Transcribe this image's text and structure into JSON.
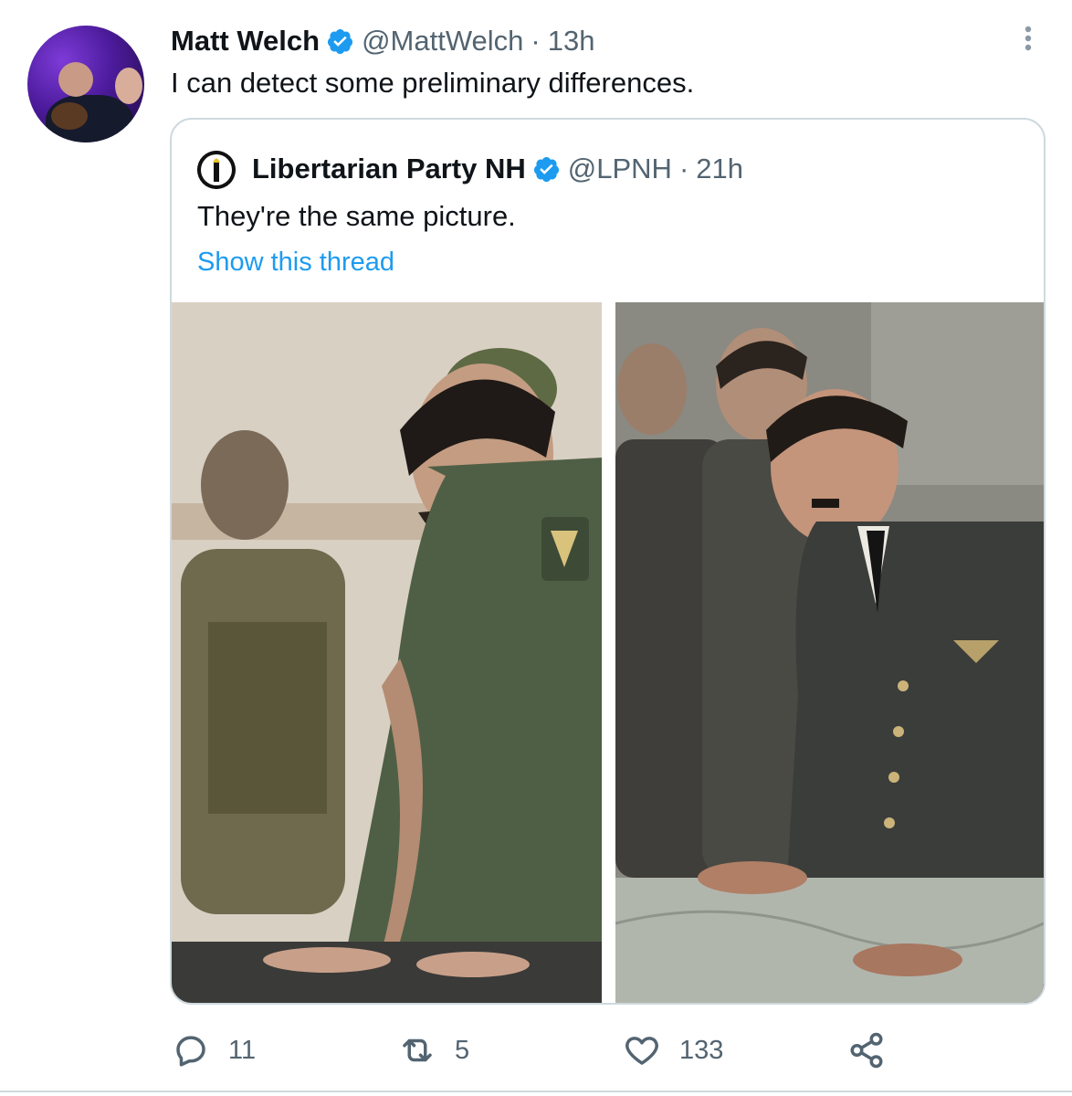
{
  "tweet": {
    "author_name": "Matt Welch",
    "author_handle": "@MattWelch",
    "separator": "·",
    "time": "13h",
    "text": "I can detect some preliminary differences.",
    "avatar_icon": "user-avatar-photo",
    "more_icon": "more-vertical-icon"
  },
  "quoted": {
    "author_name": "Libertarian Party NH",
    "author_handle": "@LPNH",
    "separator": "·",
    "time": "21h",
    "text": "They're the same picture.",
    "thread_link": "Show this thread",
    "media": [
      {
        "icon": "photo-left-soldiers-at-table"
      },
      {
        "icon": "photo-right-officers-at-map"
      }
    ]
  },
  "actions": {
    "reply_count": "11",
    "retweet_count": "5",
    "like_count": "133"
  },
  "colors": {
    "link": "#1d9bf0",
    "secondary_text": "#536471",
    "verified": "#1d9bf0",
    "border": "#cfd9de"
  }
}
